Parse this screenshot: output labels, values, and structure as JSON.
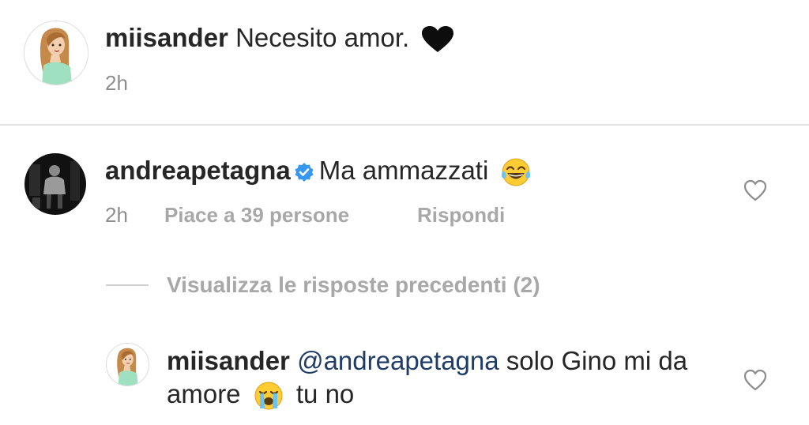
{
  "caption": {
    "username": "miisander",
    "text": "Necesito amor.",
    "emoji": "black-heart-icon",
    "time": "2h"
  },
  "comment": {
    "username": "andreapetagna",
    "verified": true,
    "text": "Ma ammazzati",
    "emoji": "tears-of-joy-icon",
    "time": "2h",
    "likes": "Piace a 39 persone",
    "reply_label": "Rispondi"
  },
  "view_previous": "Visualizza le risposte precedenti (2)",
  "reply": {
    "username": "miisander",
    "mention": "@andreapetagna",
    "text_part1": "solo Gino mi da amore",
    "emoji": "loudly-crying-icon",
    "text_part2": "tu no"
  },
  "colors": {
    "text": "#262626",
    "meta": "#8e8e8e",
    "mention": "#1f3d66",
    "verified": "#3897f0",
    "divider": "#e2e2e2"
  }
}
